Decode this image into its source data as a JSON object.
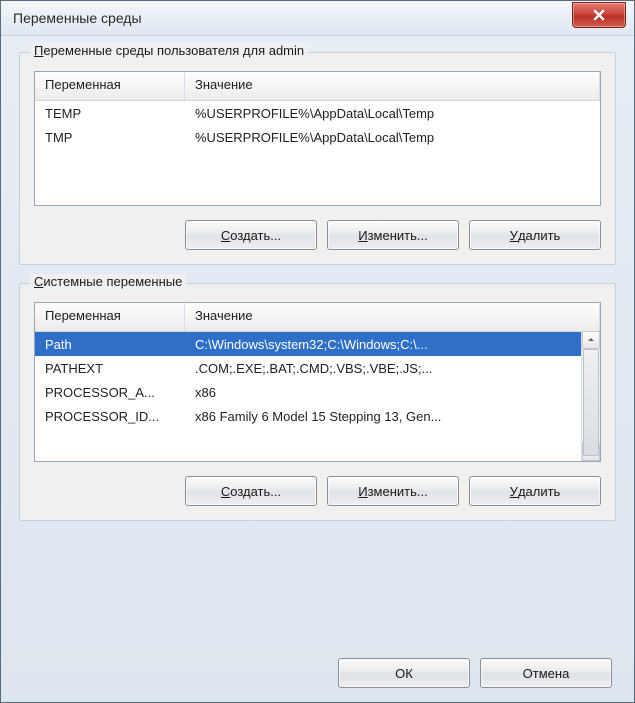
{
  "window": {
    "title": "Переменные среды"
  },
  "groups": {
    "user": {
      "legend_pre": "П",
      "legend_rest": "еременные среды пользователя для admin",
      "headers": {
        "variable": "Переменная",
        "value": "Значение"
      },
      "rows": [
        {
          "variable": "TEMP",
          "value": "%USERPROFILE%\\AppData\\Local\\Temp"
        },
        {
          "variable": "TMP",
          "value": "%USERPROFILE%\\AppData\\Local\\Temp"
        }
      ],
      "buttons": {
        "new_pre": "С",
        "new_rest": "оздать...",
        "edit_pre": "И",
        "edit_rest": "зменить...",
        "del_pre": "У",
        "del_rest": "далить"
      }
    },
    "system": {
      "legend_pre": "С",
      "legend_rest": "истемные переменные",
      "headers": {
        "variable": "Переменная",
        "value": "Значение"
      },
      "rows": [
        {
          "variable": "Path",
          "value": "C:\\Windows\\system32;C:\\Windows;C:\\..."
        },
        {
          "variable": "PATHEXT",
          "value": ".COM;.EXE;.BAT;.CMD;.VBS;.VBE;.JS;..."
        },
        {
          "variable": "PROCESSOR_A...",
          "value": "x86"
        },
        {
          "variable": "PROCESSOR_ID...",
          "value": "x86 Family 6 Model 15 Stepping 13, Gen..."
        }
      ],
      "selected_index": 0,
      "buttons": {
        "new_pre": "С",
        "new_rest": "оздать...",
        "edit_pre": "И",
        "edit_rest": "зменить...",
        "del_pre": "У",
        "del_rest": "далить"
      }
    }
  },
  "footer": {
    "ok": "ОК",
    "cancel": "Отмена"
  }
}
